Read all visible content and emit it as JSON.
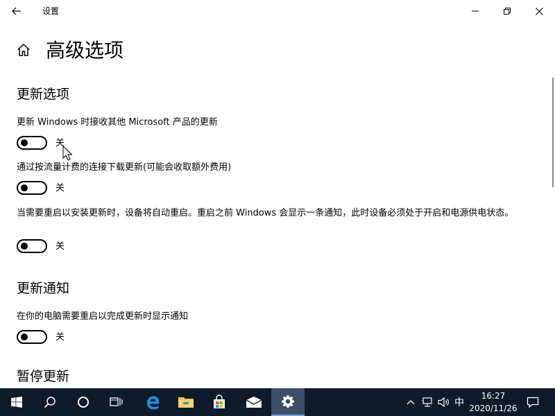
{
  "window": {
    "title": "设置"
  },
  "page": {
    "title": "高级选项"
  },
  "sections": [
    {
      "title": "更新选项",
      "settings": [
        {
          "label": "更新 Windows 时接收其他 Microsoft 产品的更新",
          "state": "关",
          "on": false
        },
        {
          "label": "通过按流量计费的连接下载更新(可能会收取额外费用)",
          "state": "关",
          "on": false
        },
        {
          "label": "当需要重启以安装更新时，设备将自动重启。重启之前 Windows 会显示一条通知，此时设备必须处于开启和电源供电状态。",
          "state": "关",
          "on": false
        }
      ]
    },
    {
      "title": "更新通知",
      "settings": [
        {
          "label": "在你的电脑需要重启以完成更新时显示通知",
          "state": "关",
          "on": false
        }
      ]
    },
    {
      "title": "暂停更新",
      "settings": []
    }
  ],
  "taskbar": {
    "items": [
      "start-icon",
      "search-icon",
      "cortana-icon",
      "task-view-icon",
      "edge-icon",
      "file-explorer-icon",
      "store-icon",
      "mail-icon",
      "settings-icon"
    ],
    "tray": {
      "ime": "中",
      "time": "16:27",
      "date": "2020/11/26"
    }
  },
  "colors": {
    "taskbar": "#0f1a2b",
    "active_taskbar_item": "#3d4f66",
    "edge": "#1e90e0",
    "folder": "#f2c14e"
  }
}
